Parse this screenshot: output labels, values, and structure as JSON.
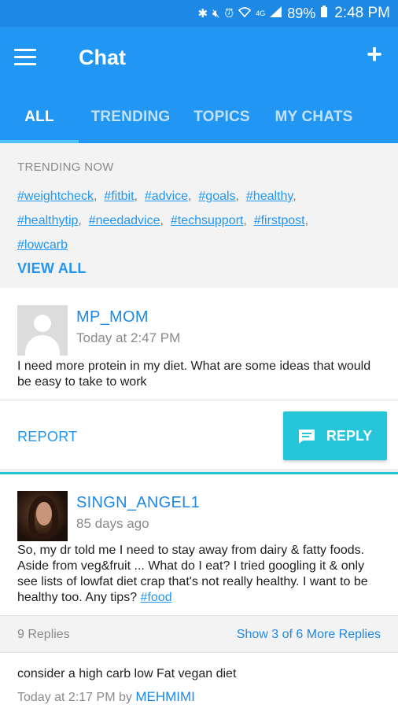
{
  "status_bar": {
    "icons": [
      "bluetooth-icon",
      "mute-icon",
      "alarm-icon",
      "wifi-icon",
      "lte-icon",
      "signal-icon"
    ],
    "battery": "89%",
    "time": "2:48 PM"
  },
  "app_bar": {
    "title": "Chat",
    "tabs": [
      {
        "label": "ALL",
        "active": true
      },
      {
        "label": "TRENDING",
        "active": false
      },
      {
        "label": "TOPICS",
        "active": false
      },
      {
        "label": "MY CHATS",
        "active": false
      }
    ]
  },
  "trending": {
    "label": "TRENDING NOW",
    "tags": [
      "#weightcheck",
      "#fitbit",
      "#advice",
      "#goals",
      "#healthy",
      "#healthytip",
      "#needadvice",
      "#techsupport",
      "#firstpost",
      "#lowcarb"
    ],
    "view_all": "VIEW ALL"
  },
  "post1": {
    "username": "MP_MOM",
    "timestamp": "Today at 2:47 PM",
    "body": "I need more protein in my diet. What are some ideas that would be easy to take to work",
    "report_label": "REPORT",
    "reply_label": "REPLY"
  },
  "post2": {
    "username": "SINGN_ANGEL1",
    "timestamp": "85 days ago",
    "body": "So, my dr told me I need to stay away from dairy & fatty foods. Aside from veg&fruit ... What do I eat? I tried googling it & only see lists of lowfat diet crap that's not really healthy. I want to be healthy too. Any tips? ",
    "body_tag": "#food",
    "replies_count": "9 Replies",
    "show_more": "Show 3 of 6 More Replies",
    "reply": {
      "text": "consider a high carb low Fat vegan diet",
      "meta": "Today at 2:17 PM by ",
      "username": "MEHMIMI"
    }
  },
  "colors": {
    "app_bar": "#2196f3",
    "status_bar": "#1e88e5",
    "accent": "#26c6da",
    "tab_indicator": "#4fc3f7"
  }
}
